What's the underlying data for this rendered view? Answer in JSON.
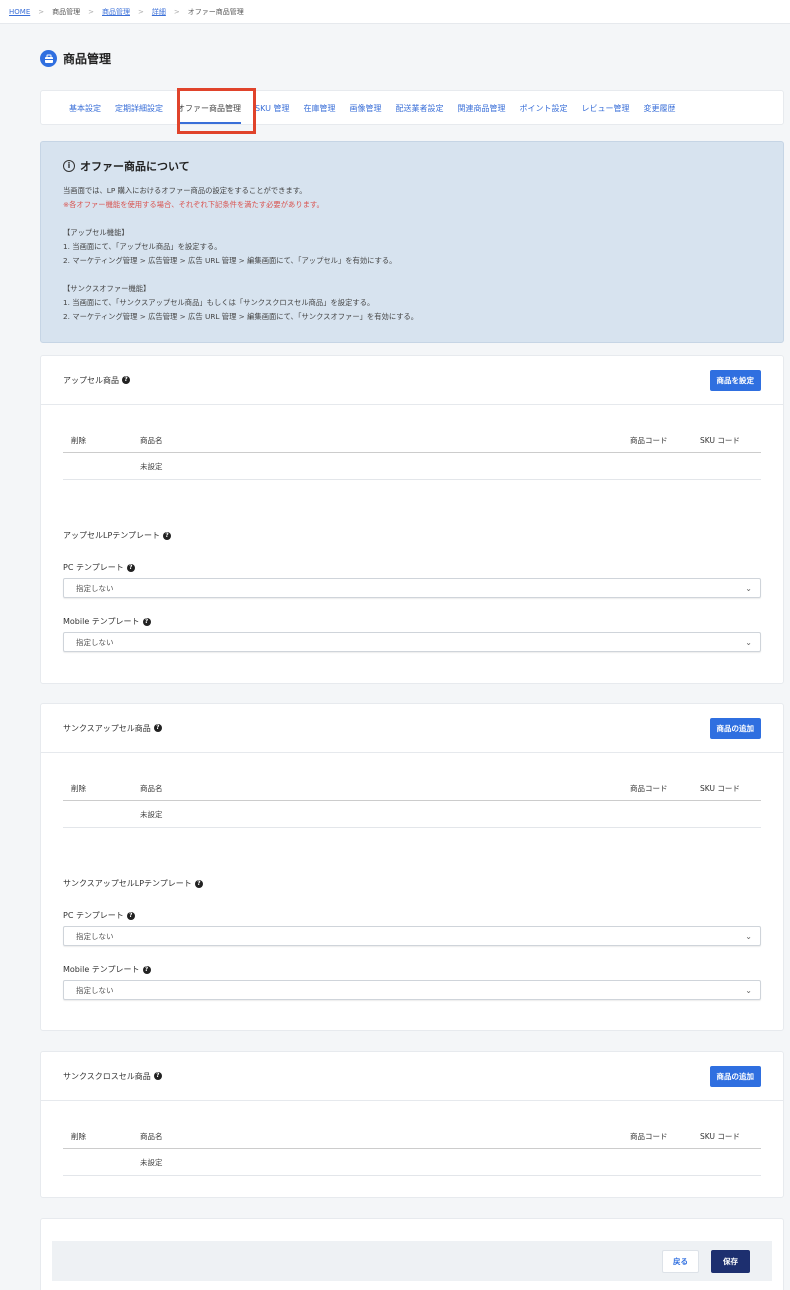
{
  "breadcrumb": {
    "items": [
      {
        "label": "HOME",
        "link": true
      },
      {
        "label": "商品管理",
        "link": false
      },
      {
        "label": "商品管理",
        "link": true
      },
      {
        "label": "詳細",
        "link": true
      },
      {
        "label": "オファー商品管理",
        "link": false
      }
    ],
    "separator": ">"
  },
  "page": {
    "title": "商品管理",
    "icon": "box-icon"
  },
  "tabs": [
    {
      "label": "基本設定"
    },
    {
      "label": "定期詳細設定"
    },
    {
      "label": "オファー商品管理",
      "active": true
    },
    {
      "label": "SKU 管理"
    },
    {
      "label": "在庫管理"
    },
    {
      "label": "画像管理"
    },
    {
      "label": "配送業者設定"
    },
    {
      "label": "関連商品管理"
    },
    {
      "label": "ポイント設定"
    },
    {
      "label": "レビュー管理"
    },
    {
      "label": "変更履歴"
    }
  ],
  "info": {
    "title": "オファー商品について",
    "line1": "当画面では、LP 購入におけるオファー商品の設定をすることができます。",
    "warning": "※各オファー機能を使用する場合、それぞれ下記条件を満たす必要があります。",
    "upsell_heading": "【アップセル機能】",
    "upsell_step1": "1. 当画面にて、「アップセル商品」を設定する。",
    "upsell_step2": "2. マーケティング管理 > 広告管理 > 広告 URL 管理 > 編集画面にて、「アップセル」を有効にする。",
    "thanks_heading": "【サンクスオファー機能】",
    "thanks_step1": "1. 当画面にて、「サンクスアップセル商品」もしくは「サンクスクロスセル商品」を設定する。",
    "thanks_step2": "2. マーケティング管理 > 広告管理 > 広告 URL 管理 > 編集画面にて、「サンクスオファー」を有効にする。"
  },
  "table_columns": {
    "delete": "削除",
    "name": "商品名",
    "code": "商品コード",
    "sku": "SKU コード"
  },
  "empty_row": "未設定",
  "upsell": {
    "title": "アップセル商品",
    "button": "商品を設定",
    "template_title": "アップセルLPテンプレート",
    "pc_label": "PC テンプレート",
    "pc_value": "指定しない",
    "mobile_label": "Mobile テンプレート",
    "mobile_value": "指定しない"
  },
  "thanks_upsell": {
    "title": "サンクスアップセル商品",
    "button": "商品の追加",
    "template_title": "サンクスアップセルLPテンプレート",
    "pc_label": "PC テンプレート",
    "pc_value": "指定しない",
    "mobile_label": "Mobile テンプレート",
    "mobile_value": "指定しない"
  },
  "thanks_cross": {
    "title": "サンクスクロスセル商品",
    "button": "商品の追加"
  },
  "footer": {
    "back": "戻る",
    "save": "保存"
  }
}
